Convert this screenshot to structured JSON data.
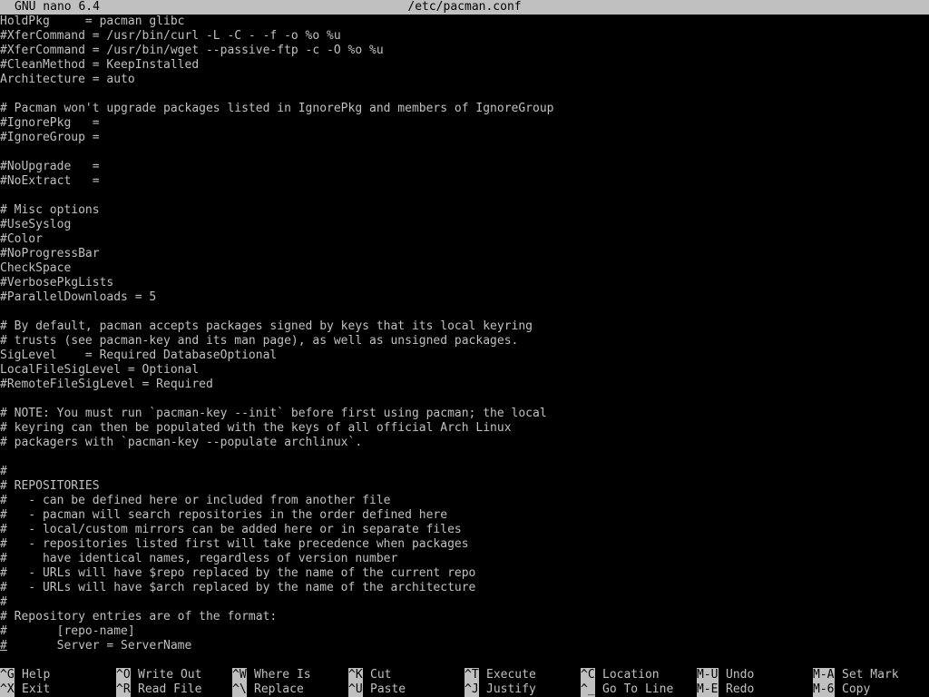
{
  "titlebar": {
    "app": "GNU nano 6.4",
    "file": "/etc/pacman.conf"
  },
  "editor": {
    "lines": [
      "HoldPkg     = pacman glibc",
      "#XferCommand = /usr/bin/curl -L -C - -f -o %o %u",
      "#XferCommand = /usr/bin/wget --passive-ftp -c -O %o %u",
      "#CleanMethod = KeepInstalled",
      "Architecture = auto",
      "",
      "# Pacman won't upgrade packages listed in IgnorePkg and members of IgnoreGroup",
      "#IgnorePkg   =",
      "#IgnoreGroup =",
      "",
      "#NoUpgrade   =",
      "#NoExtract   =",
      "",
      "# Misc options",
      "#UseSyslog",
      "#Color",
      "#NoProgressBar",
      "CheckSpace",
      "#VerbosePkgLists",
      "#ParallelDownloads = 5",
      "",
      "# By default, pacman accepts packages signed by keys that its local keyring",
      "# trusts (see pacman-key and its man page), as well as unsigned packages.",
      "SigLevel    = Required DatabaseOptional",
      "LocalFileSigLevel = Optional",
      "#RemoteFileSigLevel = Required",
      "",
      "# NOTE: You must run `pacman-key --init` before first using pacman; the local",
      "# keyring can then be populated with the keys of all official Arch Linux",
      "# packagers with `pacman-key --populate archlinux`.",
      "",
      "#",
      "# REPOSITORIES",
      "#   - can be defined here or included from another file",
      "#   - pacman will search repositories in the order defined here",
      "#   - local/custom mirrors can be added here or in separate files",
      "#   - repositories listed first will take precedence when packages",
      "#     have identical names, regardless of version number",
      "#   - URLs will have $repo replaced by the name of the current repo",
      "#   - URLs will have $arch replaced by the name of the architecture",
      "#",
      "# Repository entries are of the format:",
      "#       [repo-name]",
      "#       Server = ServerName"
    ]
  },
  "shortcuts": [
    {
      "key": "^G",
      "label": "Help"
    },
    {
      "key": "^X",
      "label": "Exit"
    },
    {
      "key": "^O",
      "label": "Write Out"
    },
    {
      "key": "^R",
      "label": "Read File"
    },
    {
      "key": "^W",
      "label": "Where Is"
    },
    {
      "key": "^\\",
      "label": "Replace"
    },
    {
      "key": "^K",
      "label": "Cut"
    },
    {
      "key": "^U",
      "label": "Paste"
    },
    {
      "key": "^T",
      "label": "Execute"
    },
    {
      "key": "^J",
      "label": "Justify"
    },
    {
      "key": "^C",
      "label": "Location"
    },
    {
      "key": "^_",
      "label": "Go To Line"
    },
    {
      "key": "M-U",
      "label": "Undo"
    },
    {
      "key": "M-E",
      "label": "Redo"
    },
    {
      "key": "M-A",
      "label": "Set Mark"
    },
    {
      "key": "M-6",
      "label": "Copy"
    }
  ],
  "colors": {
    "background": "#000000",
    "foreground": "#c0c0c0",
    "inverse_bg": "#c0c0c0",
    "inverse_fg": "#000000"
  }
}
